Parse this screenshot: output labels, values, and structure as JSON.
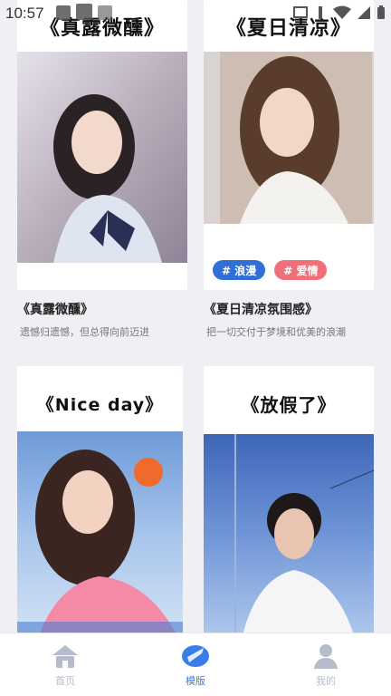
{
  "status": {
    "time": "10:57"
  },
  "cards": [
    {
      "title": "《真露微醺》",
      "name": "《真露微醺》",
      "desc": "遗憾归遗憾，但总得向前迈进"
    },
    {
      "title": "《夏日清凉》",
      "name": "《夏日清凉氛围感》",
      "desc": "把一切交付于梦境和优美的浪潮",
      "tags": [
        "# 浪漫",
        "# 爱情"
      ]
    },
    {
      "title": "《Nice day》"
    },
    {
      "title": "《放假了》"
    }
  ],
  "nav": [
    {
      "label": "首页",
      "icon": "home-icon"
    },
    {
      "label": "模版",
      "icon": "template-icon"
    },
    {
      "label": "我的",
      "icon": "profile-icon"
    }
  ],
  "colors": {
    "accent": "#3a7de6",
    "tag_blue": "#2f6fd6",
    "tag_red": "#f0707a",
    "nav_inactive": "#b5bccc"
  }
}
